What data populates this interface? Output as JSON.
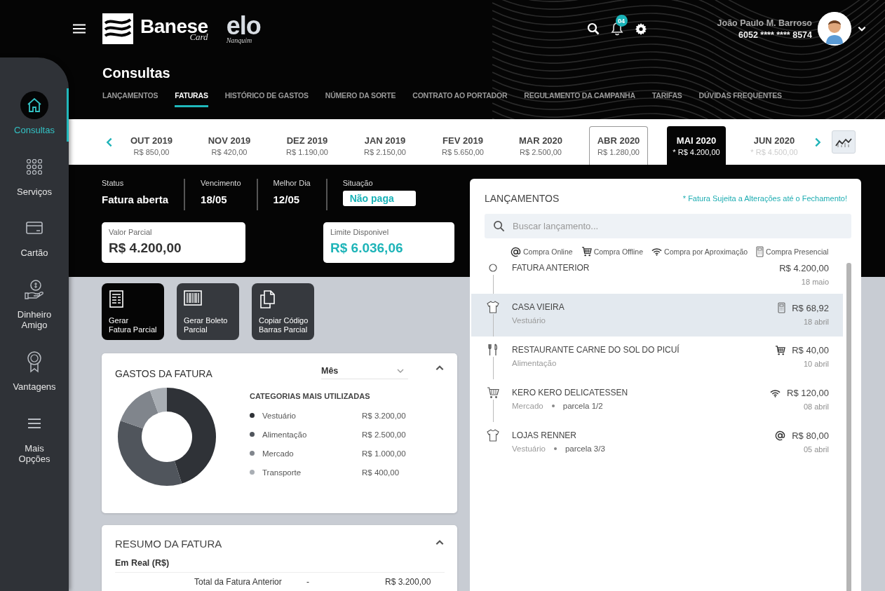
{
  "header": {
    "brand": "Banese",
    "brand_sub": "Card",
    "partner": "elo",
    "partner_sub": "Nanquim",
    "notification_count": "04",
    "user": {
      "name": "João Paulo M. Barroso",
      "card": "6052 **** **** 8574"
    }
  },
  "sidebar": {
    "items": [
      {
        "label": "Consultas",
        "kind": "home",
        "selected": true
      },
      {
        "label": "Serviços",
        "kind": "grid",
        "selected": false
      },
      {
        "label": "Cartão",
        "kind": "card",
        "selected": false
      },
      {
        "label": "Dinheiro Amigo",
        "kind": "money",
        "selected": false
      },
      {
        "label": "Vantagens",
        "kind": "medal",
        "selected": false
      },
      {
        "label": "Mais Opções",
        "kind": "menu",
        "selected": false
      }
    ]
  },
  "page": {
    "title": "Consultas"
  },
  "tabs": [
    {
      "label": "LANÇAMENTOS",
      "selected": false
    },
    {
      "label": "FATURAS",
      "selected": true
    },
    {
      "label": "HISTÓRICO DE GASTOS",
      "selected": false
    },
    {
      "label": "NÚMERO DA SORTE",
      "selected": false
    },
    {
      "label": "CONTRATO AO PORTADOR",
      "selected": false
    },
    {
      "label": "REGULAMENTO DA CAMPANHA",
      "selected": false
    },
    {
      "label": "TARIFAS",
      "selected": false
    },
    {
      "label": "DÚVIDAS FREQUENTES",
      "selected": false
    }
  ],
  "months": [
    {
      "label": "OUT 2019",
      "amount": "R$ 850,00",
      "kind": "closed",
      "selected": false
    },
    {
      "label": "NOV 2019",
      "amount": "R$ 420,00",
      "kind": "closed",
      "selected": false
    },
    {
      "label": "DEZ 2019",
      "amount": "R$ 1.190,00",
      "kind": "closed",
      "selected": false
    },
    {
      "label": "JAN 2019",
      "amount": "R$ 2.150,00",
      "kind": "closed",
      "selected": false
    },
    {
      "label": "FEV 2019",
      "amount": "R$ 5.650,00",
      "kind": "closed",
      "selected": false
    },
    {
      "label": "MAR 2020",
      "amount": "R$ 2.500,00",
      "kind": "closed",
      "selected": false
    },
    {
      "label": "ABR 2020",
      "amount": "R$ 1.280,00",
      "kind": "previous",
      "selected": false
    },
    {
      "label": "MAI 2020",
      "amount": "* R$ 4.200,00",
      "kind": "open",
      "selected": true
    },
    {
      "label": "JUN 2020",
      "amount": "* R$ 4.500,00",
      "kind": "future",
      "selected": false
    }
  ],
  "status": [
    {
      "label": "Status",
      "value": "Fatura aberta",
      "kind": "text"
    },
    {
      "label": "Vencimento",
      "value": "18/05",
      "kind": "text"
    },
    {
      "label": "Melhor Dia",
      "value": "12/05",
      "kind": "text"
    },
    {
      "label": "Situação",
      "value": "Não paga",
      "kind": "badge"
    }
  ],
  "amounts": [
    {
      "label": "Valor Parcial",
      "value": "R$ 4.200,00",
      "kind": "neutral"
    },
    {
      "label": "Limite Disponivel",
      "value": "R$ 6.036,06",
      "kind": "available"
    }
  ],
  "actions": [
    {
      "label": "Gerar\nFatura Parcial",
      "kind": "receipt",
      "selected": true
    },
    {
      "label": "Gerar Boleto\nParcial",
      "kind": "barcode",
      "selected": false
    },
    {
      "label": "Copiar Código\nBarras Parcial",
      "kind": "copy",
      "selected": false
    }
  ],
  "gastos": {
    "title": "GASTOS DA FATURA",
    "period": "Mês",
    "legend_title": "CATEGORIAS MAIS UTILIZADAS",
    "legend": [
      {
        "value": "R$ 3.200,00",
        "color": "#2f3237"
      },
      {
        "value": "R$ 2.500,00",
        "color": "#50555c"
      },
      {
        "value": "R$ 1.000,00",
        "color": "#80858c"
      },
      {
        "value": "R$ 400,00",
        "color": "#a9aeb4"
      }
    ],
    "chart_data": {
      "type": "donut",
      "categories": [
        "Vestuário",
        "Alimentação",
        "Mercado",
        "Transporte"
      ],
      "values": [
        45.1,
        35.2,
        14.1,
        5.6
      ]
    }
  },
  "resumo": {
    "title": "RESUMO DA FATURA",
    "subtitle": "Em Real (R$)",
    "rows": [
      {
        "label": "Total da Fatura Anterior",
        "sign": "-",
        "value": "R$ 3.200,00"
      }
    ]
  },
  "lancamentos": {
    "title": "LANÇAMENTOS",
    "note": "* Fatura Sujeita a Alterações até o Fechamento!",
    "search": {
      "placeholder": "Buscar lançamento..."
    },
    "payment_types": [
      {
        "kind": "online",
        "label": "Compra Online"
      },
      {
        "kind": "offline",
        "label": "Compra Offline"
      },
      {
        "kind": "contactless",
        "label": "Compra por Aproximação"
      },
      {
        "kind": "in_person",
        "label": "Compra Presencial"
      }
    ],
    "items": [
      {
        "name": "FATURA ANTERIOR",
        "category_icon": {
          "kind": "previous"
        },
        "amount": "R$ 4.200,00",
        "date": "18 maio",
        "selected": false
      },
      {
        "name": "CASA VIEIRA",
        "category": "Vestuário",
        "category_icon": {
          "kind": "clothing"
        },
        "payment_icon": {
          "kind": "in_person"
        },
        "amount": "R$ 68,92",
        "date": "18 abril",
        "selected": true
      },
      {
        "name": "RESTAURANTE CARNE DO SOL DO PICUÍ",
        "category": "Alimentação",
        "category_icon": {
          "kind": "food"
        },
        "payment_icon": {
          "kind": "offline"
        },
        "amount": "R$ 40,00",
        "date": "10 abril",
        "selected": false
      },
      {
        "name": "KERO KERO DELICATESSEN",
        "category": "Mercado",
        "installment": "parcela 1/2",
        "category_icon": {
          "kind": "market"
        },
        "payment_icon": {
          "kind": "contactless"
        },
        "amount": "R$ 120,00",
        "date": "08 abril",
        "selected": false
      },
      {
        "name": "LOJAS RENNER",
        "category": "Vestuário",
        "installment": "parcela 3/3",
        "category_icon": {
          "kind": "clothing"
        },
        "payment_icon": {
          "kind": "online"
        },
        "amount": "R$ 80,00",
        "date": "05 abril",
        "selected": false
      }
    ]
  }
}
